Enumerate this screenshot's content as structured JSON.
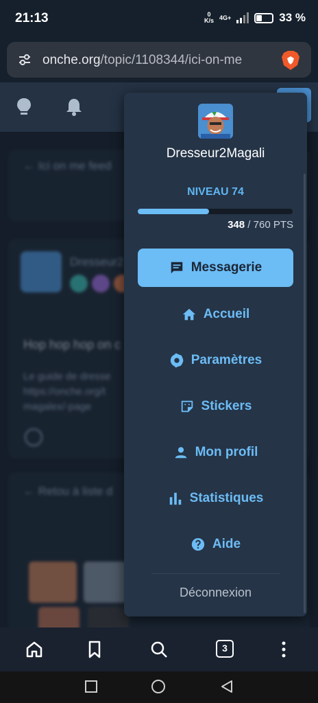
{
  "status": {
    "time": "21:13",
    "net_speed_value": "0",
    "net_speed_unit": "K/s",
    "network": "4G+",
    "battery": "33 %",
    "battery_level": 0.33
  },
  "browser": {
    "url_host": "onche.org",
    "url_path": "/topic/1108344/ici-on-me",
    "tab_count": "3"
  },
  "background": {
    "breadcrumb": "Ici on me feed",
    "author": "Dresseur2",
    "post_title": "Hop hop hop on c",
    "post_body_1": "Le guide de dresse",
    "post_body_2": "https://onche.org/t",
    "post_body_3": "magalex/-page",
    "back_link": "Retou à liste d"
  },
  "dropdown": {
    "username": "Dresseur2Magali",
    "level_label": "NIVEAU 74",
    "points_current": "348",
    "points_total": "/ 760 PTS",
    "progress": 0.458,
    "menu": [
      {
        "label": "Messagerie",
        "icon": "message-icon",
        "active": true
      },
      {
        "label": "Accueil",
        "icon": "home-icon"
      },
      {
        "label": "Paramètres",
        "icon": "gear-icon"
      },
      {
        "label": "Stickers",
        "icon": "sticker-icon"
      },
      {
        "label": "Mon profil",
        "icon": "person-icon"
      },
      {
        "label": "Statistiques",
        "icon": "bar-chart-icon"
      },
      {
        "label": "Aide",
        "icon": "help-icon"
      }
    ],
    "logout": "Déconnexion"
  },
  "colors": {
    "accent": "#6cbcf5",
    "menu_bg": "#253447",
    "header_bg": "#243244"
  }
}
